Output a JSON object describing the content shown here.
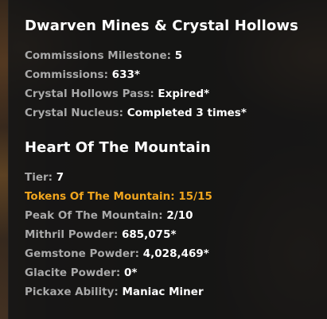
{
  "dwarven": {
    "title": "Dwarven Mines & Crystal Hollows",
    "stats": [
      {
        "label": "Commissions Milestone: ",
        "value": "5"
      },
      {
        "label": "Commissions: ",
        "value": "633*"
      },
      {
        "label": "Crystal Hollows Pass: ",
        "value": "Expired*"
      },
      {
        "label": "Crystal Nucleus: ",
        "value": "Completed 3 times*"
      }
    ]
  },
  "hotm": {
    "title": "Heart Of The Mountain",
    "stats": [
      {
        "label": "Tier: ",
        "value": "7"
      },
      {
        "label": "Tokens Of The Mountain: ",
        "value": "15/15"
      },
      {
        "label": "Peak Of The Mountain: ",
        "value": "2/10"
      },
      {
        "label": "Mithril Powder: ",
        "value": "685,075*"
      },
      {
        "label": "Gemstone Powder: ",
        "value": "4,028,469*"
      },
      {
        "label": "Glacite Powder: ",
        "value": "0*"
      },
      {
        "label": "Pickaxe Ability: ",
        "value": "Maniac Miner"
      }
    ]
  },
  "colors": {
    "heading": "#ffffff",
    "label": "#a9a9a9",
    "value": "#ffffff",
    "highlight": "#f0a51e",
    "panel": "#161616"
  }
}
